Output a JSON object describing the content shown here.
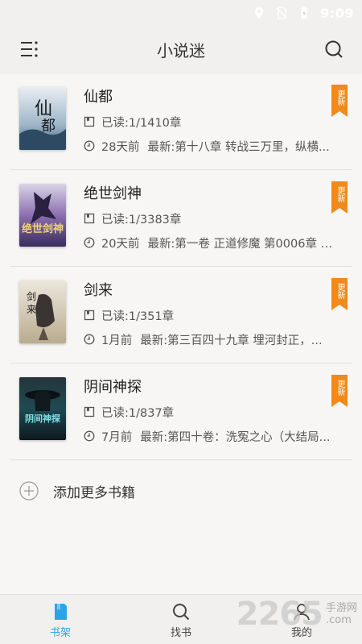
{
  "status_bar": {
    "time": "9:09",
    "icons": [
      "location-icon",
      "sim-off-icon",
      "battery-icon"
    ]
  },
  "header": {
    "title": "小说迷",
    "menu_icon": "menu-icon",
    "search_icon": "search-icon"
  },
  "books": [
    {
      "title": "仙都",
      "progress": "已读:1/1410章",
      "time": "28天前",
      "latest": "最新:第十八章 转战三万里，纵横...",
      "badge": "更新"
    },
    {
      "title": "绝世剑神",
      "progress": "已读:1/3383章",
      "time": "20天前",
      "latest": "最新:第一卷 正道修魔 第0006章 亡...",
      "badge": "更新"
    },
    {
      "title": "剑来",
      "progress": "已读:1/351章",
      "time": "1月前",
      "latest": "最新:第三百四十九章 埋河封正，...",
      "badge": "更新"
    },
    {
      "title": "阴间神探",
      "progress": "已读:1/837章",
      "time": "7月前",
      "latest": "最新:第四十卷：洗冤之心（大结局...",
      "badge": "更新"
    }
  ],
  "add_more": {
    "label": "添加更多书籍"
  },
  "tabs": [
    {
      "label": "书架",
      "icon": "bookshelf-icon",
      "active": true
    },
    {
      "label": "找书",
      "icon": "find-book-icon",
      "active": false
    },
    {
      "label": "我的",
      "icon": "profile-icon",
      "active": false
    }
  ],
  "watermark": {
    "number": "2265",
    "site": "手游网",
    "domain": ".com"
  },
  "colors": {
    "accent": "#2aa4e8",
    "badge": "#f08a1c",
    "background": "#f7f6f4",
    "header": "#f1f0ee"
  }
}
